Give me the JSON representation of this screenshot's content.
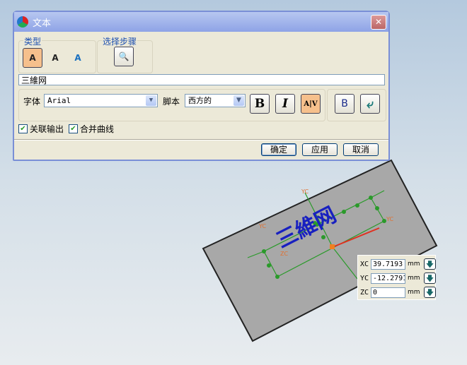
{
  "dialog": {
    "title": "文本",
    "close_icon": "close-icon",
    "type_group": {
      "label": "类型",
      "options": [
        {
          "name": "planar-text",
          "active": true
        },
        {
          "name": "text-on-curve",
          "active": false
        },
        {
          "name": "text-on-face",
          "active": false
        }
      ]
    },
    "selection_group": {
      "label": "选择步骤"
    },
    "text_value": "三維网",
    "font_label": "字体",
    "font_value": "Arial",
    "script_label": "脚本",
    "script_value": "西方的",
    "bold": "B",
    "italic": "I",
    "kerning": "A|V",
    "frame": "B",
    "checkbox_associative": {
      "label": "关联输出",
      "checked": true
    },
    "checkbox_merge": {
      "label": "合并曲线",
      "checked": true
    },
    "ok": "确定",
    "apply": "应用",
    "cancel": "取消"
  },
  "viewport": {
    "axis_labels": [
      "YC",
      "YC",
      "YC",
      "ZC"
    ],
    "text_preview": "三維网"
  },
  "coords": {
    "unit": "mm",
    "rows": [
      {
        "label": "XC",
        "value": "39.7193"
      },
      {
        "label": "YC",
        "value": "-12.2791"
      },
      {
        "label": "ZC",
        "value": "0"
      }
    ]
  }
}
